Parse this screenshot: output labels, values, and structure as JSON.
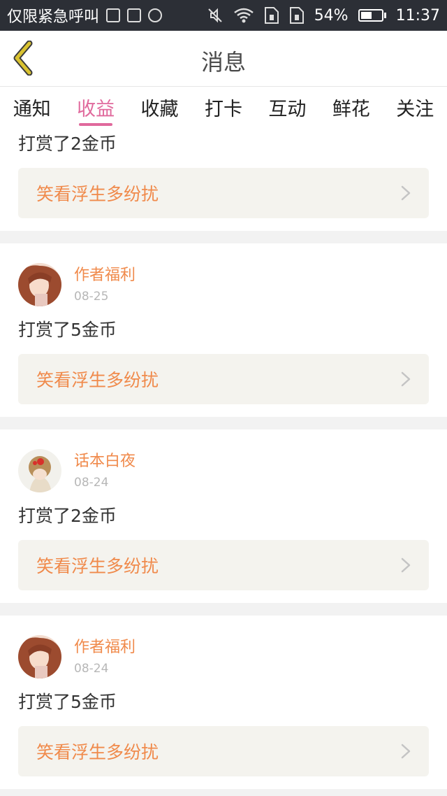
{
  "status_bar": {
    "carrier": "仅限紧急呼叫",
    "battery": "54%",
    "battery_level": 0.54,
    "time": "11:37"
  },
  "header": {
    "title": "消息"
  },
  "tabs": [
    {
      "label": "通知",
      "active": false
    },
    {
      "label": "收益",
      "active": true
    },
    {
      "label": "收藏",
      "active": false
    },
    {
      "label": "打卡",
      "active": false
    },
    {
      "label": "互动",
      "active": false
    },
    {
      "label": "鲜花",
      "active": false
    },
    {
      "label": "关注",
      "active": false
    }
  ],
  "messages": [
    {
      "text": "打赏了2金币",
      "work": "笑看浮生多纷扰"
    },
    {
      "author": "作者福利",
      "date": "08-25",
      "text": "打赏了5金币",
      "work": "笑看浮生多纷扰",
      "avatar": "girl-avatar"
    },
    {
      "author": "话本白夜",
      "date": "08-24",
      "text": "打赏了2金币",
      "work": "笑看浮生多纷扰",
      "avatar": "bun-avatar"
    },
    {
      "author": "作者福利",
      "date": "08-24",
      "text": "打赏了5金币",
      "work": "笑看浮生多纷扰",
      "avatar": "girl-avatar"
    }
  ],
  "colors": {
    "accent_tab": "#e0699c",
    "author": "#f08a4b",
    "link_bg": "#f4f3ee",
    "back_chevron": "#d9c230"
  }
}
